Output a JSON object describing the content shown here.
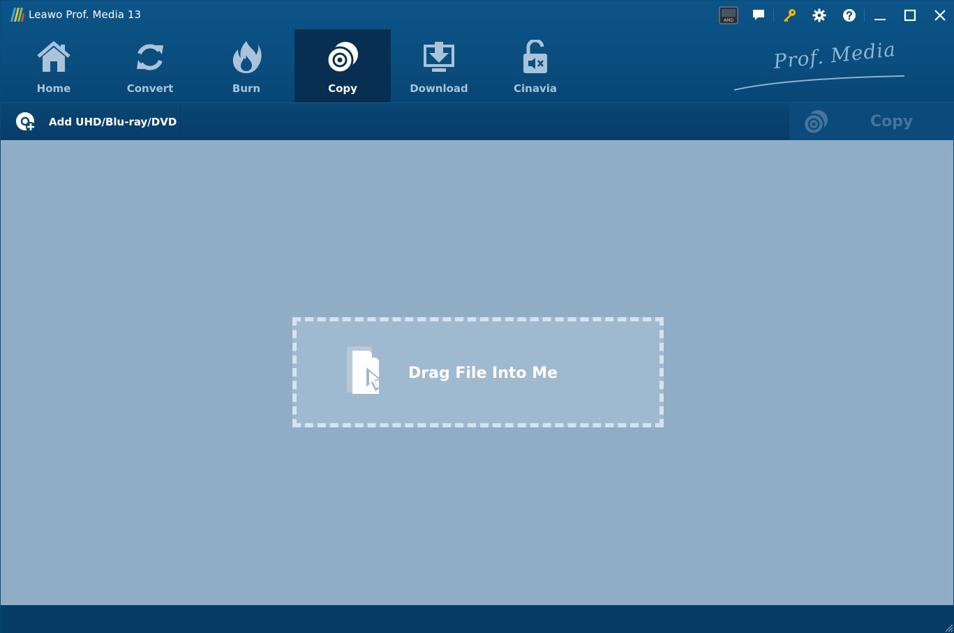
{
  "window": {
    "title": "Leawo Prof. Media 13"
  },
  "title_icons": [
    "gpu-badge-icon",
    "feedback-icon",
    "register-key-icon",
    "settings-icon",
    "help-icon"
  ],
  "gpu_badge": {
    "text": "AMD"
  },
  "window_controls": [
    "minimize-icon",
    "maximize-icon",
    "close-icon"
  ],
  "nav": {
    "items": [
      {
        "label": "Home",
        "icon": "home-icon"
      },
      {
        "label": "Convert",
        "icon": "convert-icon"
      },
      {
        "label": "Burn",
        "icon": "burn-icon"
      },
      {
        "label": "Copy",
        "icon": "copy-disc-icon",
        "active": true
      },
      {
        "label": "Download",
        "icon": "download-icon"
      },
      {
        "label": "Cinavia",
        "icon": "cinavia-icon"
      }
    ]
  },
  "brand": {
    "text": "Prof. Media"
  },
  "toolbar": {
    "add_label": "Add UHD/Blu-ray/DVD",
    "copy_label": "Copy"
  },
  "dropzone": {
    "label": "Drag File Into Me"
  },
  "colors": {
    "accent_dark": "#062f52",
    "title_bar": "#0c5588",
    "content_bg": "#8faec5",
    "key_icon": "#f5b400"
  }
}
